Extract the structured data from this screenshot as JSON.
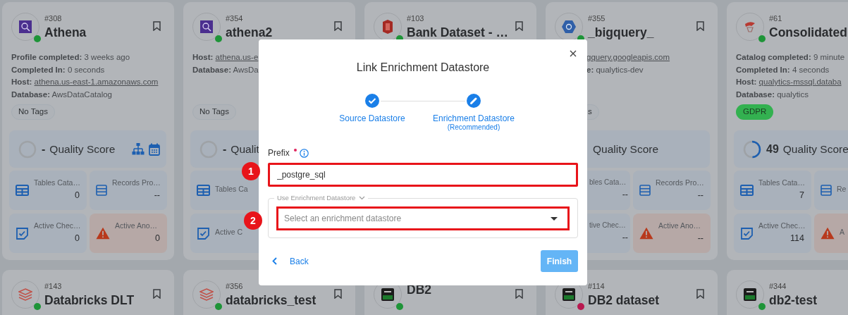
{
  "cards": [
    {
      "number": "#308",
      "title": "Athena",
      "kind": "athena",
      "color": "#1e9438",
      "bookmark": true,
      "lines": [
        {
          "label": "Profile completed:",
          "value": "3 weeks ago"
        },
        {
          "label": "Completed In:",
          "value": "0 seconds"
        },
        {
          "label": "Host:",
          "value": "athena.us-east-1.amazonaws.com",
          "link": true
        },
        {
          "label": "Database:",
          "value": "AwsDataCatalog"
        }
      ],
      "tags": [
        {
          "label": "No Tags"
        }
      ],
      "quality": {
        "score": "-",
        "label": "Quality Score",
        "level": 0,
        "actions": true
      },
      "tiles": [
        {
          "kind": "tables",
          "label": "Tables Cata…",
          "value": "0"
        },
        {
          "kind": "records",
          "label": "Records Pro…",
          "value": "--"
        },
        {
          "kind": "checks",
          "label": "Active Chec…",
          "value": "0"
        },
        {
          "kind": "anomalies",
          "label": "Active Ano…",
          "value": "0"
        }
      ]
    },
    {
      "number": "#354",
      "title": "athena2",
      "kind": "athena",
      "color": "#1e9438",
      "bookmark": true,
      "lines": [
        {
          "label": "Host:",
          "value": "athena.us-e",
          "link": true
        },
        {
          "label": "Database:",
          "value": "AwsDa"
        }
      ],
      "tags": [
        {
          "label": "No Tags"
        }
      ],
      "quality": {
        "score": "-",
        "label": "Qualit",
        "level": 0
      },
      "tiles": [
        {
          "kind": "tables",
          "label": "Tables Ca"
        },
        {
          "kind": "checks",
          "label": "Active C"
        }
      ]
    },
    {
      "number": "#103",
      "title": "Bank Dataset - …",
      "kind": "bank",
      "color": "#1e9438",
      "bookmark": true
    },
    {
      "number": "#355",
      "title": "_bigquery_",
      "kind": "bigquery",
      "color": "#1e9438",
      "bookmark": true,
      "covered": true,
      "lines": [
        {
          "value": "gquery.googleapis.com",
          "link": true
        },
        {
          "label": "e:",
          "value": "qualytics-dev"
        }
      ],
      "tags": [
        {
          "label": "s"
        }
      ],
      "quality": {
        "label": "Quality Score"
      },
      "tiles": [
        {
          "kind": "tables",
          "label": "bles Cata…",
          "value": "--"
        },
        {
          "kind": "records",
          "label": "Records Pro…",
          "value": "--"
        },
        {
          "kind": "checks",
          "label": "tive Chec…",
          "value": "--"
        },
        {
          "kind": "anomalies",
          "label": "Active Ano…",
          "value": "--"
        }
      ]
    },
    {
      "number": "#61",
      "title": "Consolidated",
      "kind": "mssql",
      "color": "#1e9438",
      "bookmark": false,
      "lines": [
        {
          "label": "Catalog completed:",
          "value": "9 minute"
        },
        {
          "label": "Completed In:",
          "value": "4 seconds"
        },
        {
          "label": "Host:",
          "value": "qualytics-mssql.databa",
          "link": true
        },
        {
          "label": "Database:",
          "value": "qualytics"
        }
      ],
      "tags": [
        {
          "label": "GDPR",
          "color": "#33b150"
        }
      ],
      "quality": {
        "score": "49",
        "label": "Quality Score",
        "level": 0.49
      },
      "tiles": [
        {
          "kind": "tables",
          "label": "Tables Cata…",
          "value": "7"
        },
        {
          "kind": "records",
          "label": "Re"
        },
        {
          "kind": "checks",
          "label": "Active Chec…",
          "value": "114"
        },
        {
          "kind": "anomalies",
          "label": "A"
        }
      ]
    },
    {
      "number": "#143",
      "title": "Databricks DLT",
      "kind": "databricks",
      "color": "#1e9438",
      "bookmark": true
    },
    {
      "number": "#356",
      "title": "databricks_test",
      "kind": "databricks",
      "color": "#1e9438",
      "bookmark": true
    },
    {
      "title": "DB2",
      "kind": "ibm",
      "color": "#1e9438",
      "bookmark": true
    },
    {
      "number": "#114",
      "title": "DB2 dataset",
      "kind": "ibm",
      "color": "#b8184f",
      "bookmark": true
    },
    {
      "number": "#344",
      "title": "db2-test",
      "kind": "ibm",
      "color": "#1e9438",
      "bookmark": false
    }
  ],
  "dialog": {
    "title": "Link Enrichment Datastore",
    "steps": [
      {
        "label": "Source Datastore",
        "kind": "done"
      },
      {
        "label": "Enrichment Datastore",
        "note": "(Recommended)",
        "kind": "current"
      }
    ],
    "prefix": {
      "label": "Prefix",
      "required": true,
      "value": "_postgre_sql",
      "highlighted": true,
      "marker": "1"
    },
    "enrichment": {
      "legend": "Use Enrichment Datastore",
      "placeholder": "Select an enrichment datastore",
      "highlighted": true,
      "marker": "2"
    },
    "back": "Back",
    "finish": {
      "label": "Finish",
      "disabled": true
    }
  }
}
